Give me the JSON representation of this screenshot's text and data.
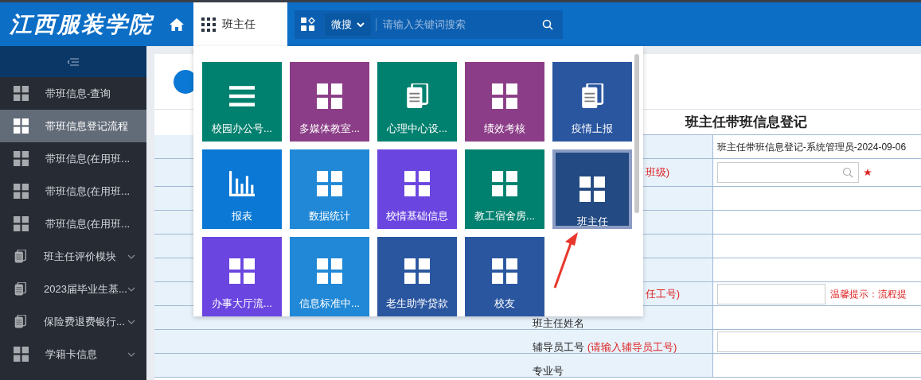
{
  "header": {
    "logo": "江西服装学院",
    "active_tab": {
      "label": "班主任",
      "selected": true
    },
    "search": {
      "scope": "微搜",
      "placeholder": "请输入关键词搜索"
    }
  },
  "sidebar": {
    "items": [
      {
        "label": "带班信息-查询",
        "kind": "grid",
        "selected": false,
        "expandable": false
      },
      {
        "label": "带班信息登记流程",
        "kind": "grid",
        "selected": true,
        "expandable": false
      },
      {
        "label": "带班信息(在用班...",
        "kind": "grid",
        "selected": false,
        "expandable": false
      },
      {
        "label": "带班信息(在用班...",
        "kind": "grid",
        "selected": false,
        "expandable": false
      },
      {
        "label": "带班信息(在用班...",
        "kind": "grid",
        "selected": false,
        "expandable": false
      },
      {
        "label": "班主任评价模块",
        "kind": "docs",
        "selected": false,
        "expandable": true
      },
      {
        "label": "2023届毕业生基...",
        "kind": "docs",
        "selected": false,
        "expandable": true
      },
      {
        "label": "保险费退费银行...",
        "kind": "docs",
        "selected": false,
        "expandable": true
      },
      {
        "label": "学籍卡信息",
        "kind": "grid",
        "selected": false,
        "expandable": true
      }
    ]
  },
  "app_menu": {
    "tiles": [
      {
        "label": "校园办公号...",
        "kind": "list",
        "color": "#00806e",
        "selected": false
      },
      {
        "label": "多媒体教室...",
        "kind": "grid",
        "color": "#8b3d87",
        "selected": false
      },
      {
        "label": "心理中心设...",
        "kind": "docs",
        "color": "#00806e",
        "selected": false
      },
      {
        "label": "绩效考核",
        "kind": "grid",
        "color": "#8b3d87",
        "selected": false
      },
      {
        "label": "疫情上报",
        "kind": "docs",
        "color": "#2a56a0",
        "selected": false
      },
      {
        "label": "报表",
        "kind": "chart",
        "color": "#0a78d4",
        "selected": false
      },
      {
        "label": "数据统计",
        "kind": "grid",
        "color": "#2088d6",
        "selected": false
      },
      {
        "label": "校情基础信息",
        "kind": "grid",
        "color": "#6a45e0",
        "selected": false
      },
      {
        "label": "教工宿舍房...",
        "kind": "grid",
        "color": "#00806e",
        "selected": false
      },
      {
        "label": "班主任",
        "kind": "grid",
        "color": "#234a82",
        "selected": true
      },
      {
        "label": "办事大厅流...",
        "kind": "grid",
        "color": "#6a45e0",
        "selected": false
      },
      {
        "label": "信息标准中...",
        "kind": "grid",
        "color": "#2088d6",
        "selected": false
      },
      {
        "label": "老生助学贷款",
        "kind": "grid",
        "color": "#2a56a0",
        "selected": false
      },
      {
        "label": "校友",
        "kind": "grid",
        "color": "#2a56a0",
        "selected": false
      }
    ]
  },
  "form": {
    "title": "班主任带班信息登记",
    "rows": [
      {
        "kind": "text",
        "value": "班主任带班信息登记-系统管理员-2024-09-06"
      },
      {
        "kind": "lookup",
        "hint_label": "班级)",
        "required": true
      },
      {
        "kind": "empty"
      },
      {
        "kind": "empty"
      },
      {
        "kind": "empty"
      },
      {
        "kind": "empty"
      },
      {
        "kind": "input",
        "hint_label": "任工号)",
        "note": "温馨提示：流程提"
      },
      {
        "kind": "empty",
        "label": "班主任姓名"
      },
      {
        "kind": "input",
        "label": "辅导员工号",
        "hint_label": "(请输入辅导员工号)"
      },
      {
        "kind": "empty",
        "label": "专业号"
      }
    ]
  }
}
